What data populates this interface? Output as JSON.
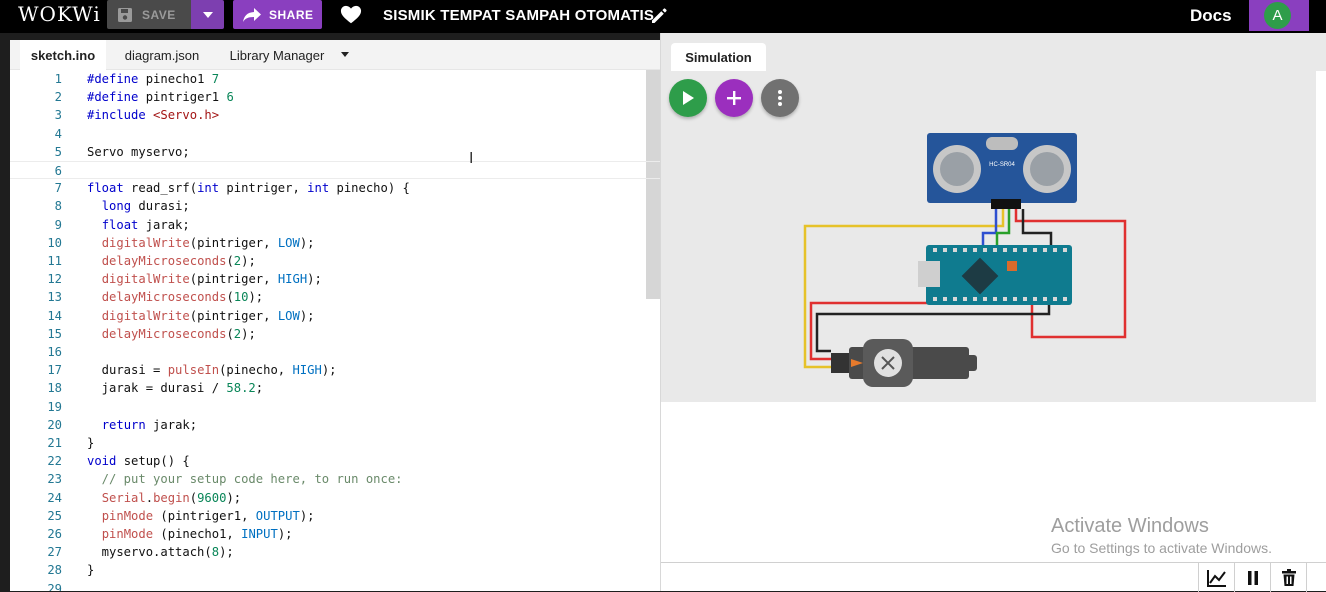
{
  "topbar": {
    "logo": "WOKWi",
    "save_label": "SAVE",
    "share_label": "SHARE",
    "project_title": "SISMIK TEMPAT SAMPAH OTOMATIS",
    "docs_label": "Docs",
    "avatar_letter": "A",
    "accent_color": "#8a3fbf"
  },
  "editor": {
    "tabs": [
      "sketch.ino",
      "diagram.json",
      "Library Manager"
    ],
    "active_tab": "sketch.ino",
    "lines": [
      {
        "n": "1",
        "text": "#define pinecho1 7"
      },
      {
        "n": "2",
        "text": "#define pintriger1 6"
      },
      {
        "n": "3",
        "text": "#include <Servo.h>"
      },
      {
        "n": "4",
        "text": ""
      },
      {
        "n": "5",
        "text": "Servo myservo;"
      },
      {
        "n": "6",
        "text": ""
      },
      {
        "n": "7",
        "text": "float read_srf(int pintriger, int pinecho) {"
      },
      {
        "n": "8",
        "text": "  long durasi;"
      },
      {
        "n": "9",
        "text": "  float jarak;"
      },
      {
        "n": "10",
        "text": "  digitalWrite(pintriger, LOW);"
      },
      {
        "n": "11",
        "text": "  delayMicroseconds(2);"
      },
      {
        "n": "12",
        "text": "  digitalWrite(pintriger, HIGH);"
      },
      {
        "n": "13",
        "text": "  delayMicroseconds(10);"
      },
      {
        "n": "14",
        "text": "  digitalWrite(pintriger, LOW);"
      },
      {
        "n": "15",
        "text": "  delayMicroseconds(2);"
      },
      {
        "n": "16",
        "text": ""
      },
      {
        "n": "17",
        "text": "  durasi = pulseIn(pinecho, HIGH);"
      },
      {
        "n": "18",
        "text": "  jarak = durasi / 58.2;"
      },
      {
        "n": "19",
        "text": ""
      },
      {
        "n": "20",
        "text": "  return jarak;"
      },
      {
        "n": "21",
        "text": "}"
      },
      {
        "n": "22",
        "text": "void setup() {"
      },
      {
        "n": "23",
        "text": "  // put your setup code here, to run once:"
      },
      {
        "n": "24",
        "text": "  Serial.begin(9600);"
      },
      {
        "n": "25",
        "text": "  pinMode (pintriger1, OUTPUT);"
      },
      {
        "n": "26",
        "text": "  pinMode (pinecho1, INPUT);"
      },
      {
        "n": "27",
        "text": "  myservo.attach(8);"
      },
      {
        "n": "28",
        "text": "}"
      },
      {
        "n": "29",
        "text": ""
      }
    ]
  },
  "simulation": {
    "tab_label": "Simulation",
    "sensor_label": "HC-SR04",
    "buttons": {
      "play": "play-icon",
      "add": "plus-icon",
      "more": "more-vertical-icon"
    },
    "console_controls": [
      "chart-icon",
      "pause-icon",
      "trash-icon"
    ]
  },
  "watermark": {
    "title": "Activate Windows",
    "subtitle": "Go to Settings to activate Windows."
  }
}
